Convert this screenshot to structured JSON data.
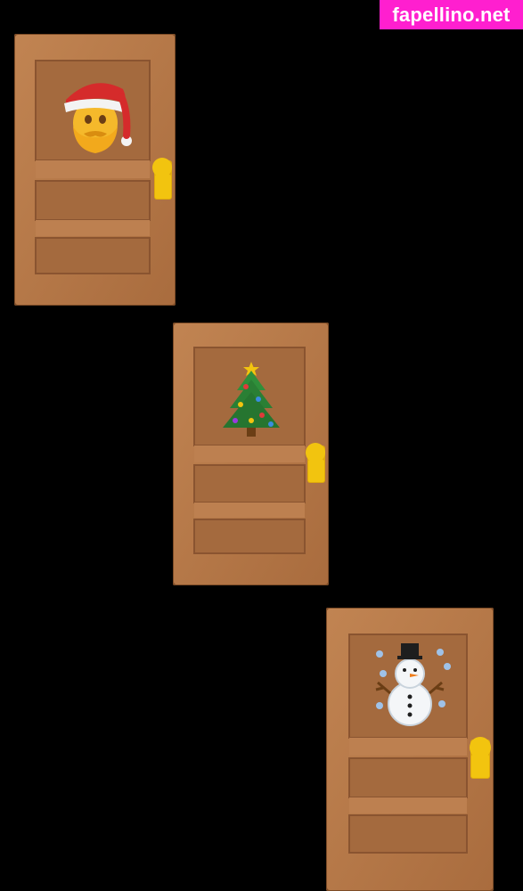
{
  "watermark": {
    "text": "fapellino.net",
    "color": "#ff1fcf"
  },
  "doors": [
    {
      "emoji_icon": "santa-face-icon"
    },
    {
      "emoji_icon": "christmas-tree-icon"
    },
    {
      "emoji_icon": "snowman-icon"
    }
  ],
  "colors": {
    "background": "#000000",
    "door_wood": "#b8794a",
    "knob": "#f2c40f"
  }
}
